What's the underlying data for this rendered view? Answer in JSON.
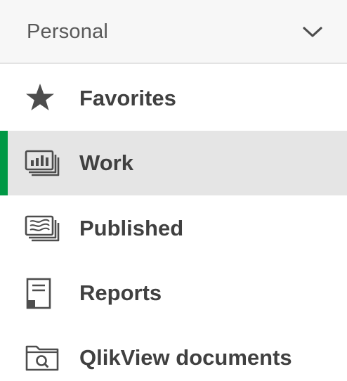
{
  "section": {
    "title": "Personal"
  },
  "nav": {
    "items": [
      {
        "label": "Favorites",
        "icon": "star-icon"
      },
      {
        "label": "Work",
        "icon": "work-sheets-icon",
        "selected": true
      },
      {
        "label": "Published",
        "icon": "published-icon"
      },
      {
        "label": "Reports",
        "icon": "report-icon"
      },
      {
        "label": "QlikView documents",
        "icon": "qlikview-folder-icon"
      }
    ]
  },
  "colors": {
    "accent": "#009845",
    "selected_bg": "#e5e5e5",
    "header_bg": "#f7f7f7",
    "text": "#404040",
    "icon": "#4d4d4d"
  }
}
